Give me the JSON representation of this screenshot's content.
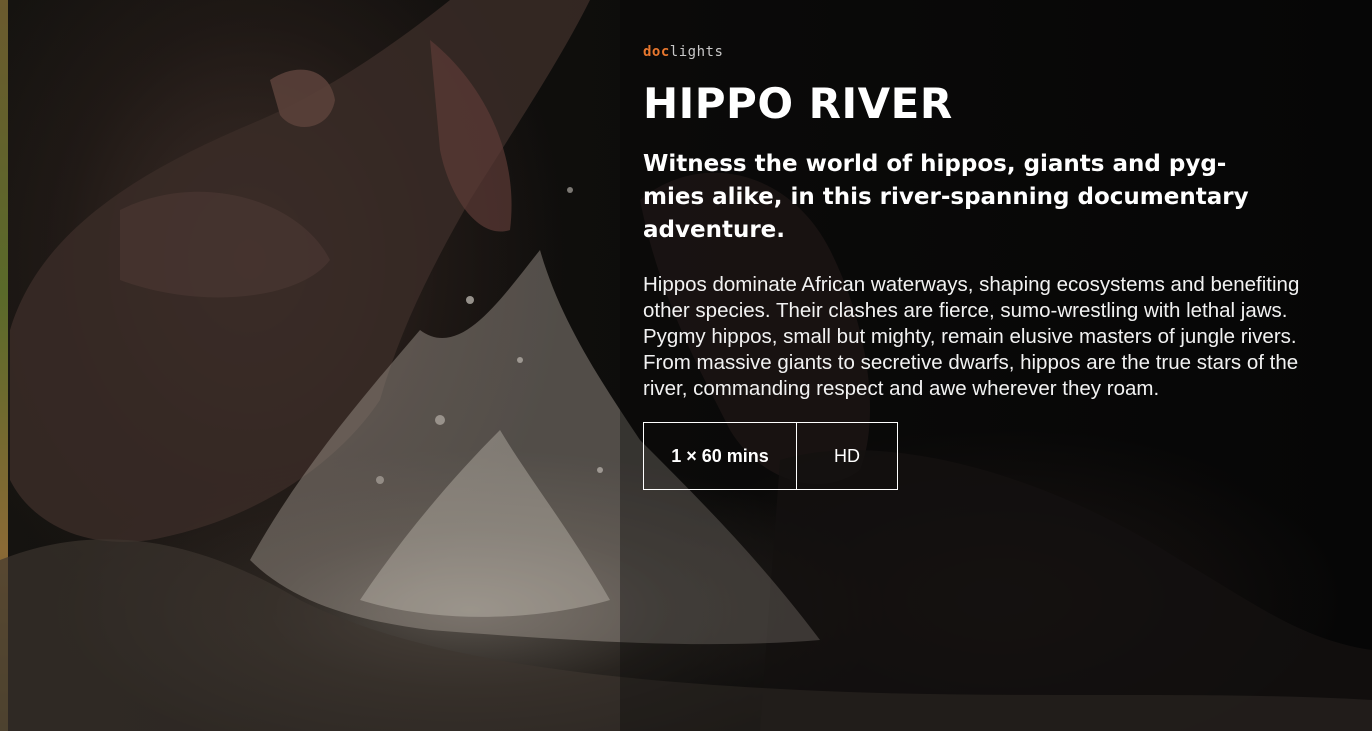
{
  "brand": {
    "logo_text_a": "doc",
    "logo_text_b": "lights"
  },
  "program": {
    "title": "HIPPO RIVER",
    "tagline": "Witness the world of hippos, giants and pyg-mies alike, in this river-spanning documentary adventure.",
    "description": "Hippos dominate African waterways, shaping ecosystems and benefiting other species. Their clashes are fierce, sumo-wrestling with lethal jaws. Pygmy hippos, small but mighty, remain elusive masters of jungle rivers. From massive giants to secretive dwarfs, hippos are the true stars of the river, commanding respect and awe wherever they roam.",
    "specs": {
      "duration": "1 × 60 mins",
      "format": "HD"
    }
  },
  "colors": {
    "brand_accent": "#e8772e",
    "text": "#ffffff",
    "background": "#0a0a09"
  }
}
